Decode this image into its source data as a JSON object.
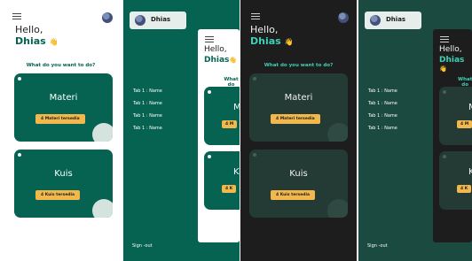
{
  "home": {
    "greeting": "Hello,",
    "user_name": "Dhias",
    "wave": "👋",
    "question": "What do you want to do?",
    "cards": [
      {
        "title": "Materi",
        "badge": "4 Materi tersedia"
      },
      {
        "title": "Kuis",
        "badge": "4 Kuis tersedia"
      }
    ]
  },
  "drawer": {
    "user_name": "Dhias",
    "tabs": [
      "Tab 1 : Name",
      "Tab 1 : Name",
      "Tab 1 : Name",
      "Tab 1 : Name"
    ],
    "signout": "Sign -out"
  },
  "inset_partial": {
    "greeting": "Hello,",
    "user_name": "Dhias",
    "question_fragment": "What do",
    "card1_fragment": "M",
    "card1_badge": "4 M",
    "card2_fragment": "K",
    "card2_badge": "4 K"
  },
  "colors": {
    "primary_green": "#066351",
    "accent_yellow": "#f2b84b",
    "dark_bg": "#1d1d1d",
    "dark_card": "#243b35",
    "dark_teal_bg": "#1b4a40",
    "light_bg": "#ffffff"
  },
  "icons": {
    "menu": "hamburger-icon",
    "avatar": "user-avatar",
    "wave": "waving-hand-icon"
  }
}
